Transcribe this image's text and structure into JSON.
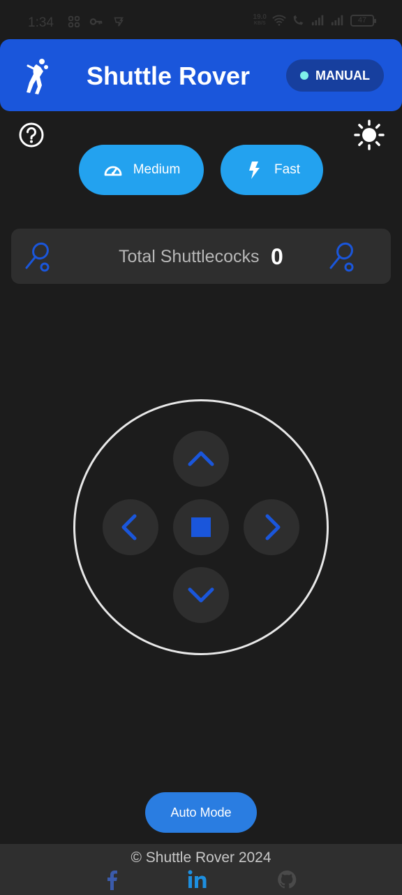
{
  "status_bar": {
    "time": "1:34",
    "net_speed_value": "19.0",
    "net_speed_unit": "KB/S",
    "battery": "47"
  },
  "header": {
    "title": "Shuttle Rover",
    "mode_badge": "MANUAL",
    "brand_color": "#1a56db"
  },
  "speed_buttons": [
    {
      "label": "Medium",
      "icon": "speedometer-icon"
    },
    {
      "label": "Fast",
      "icon": "bolt-icon"
    }
  ],
  "counter": {
    "label": "Total Shuttlecocks",
    "value": "0"
  },
  "controls": {
    "buttons": [
      "up",
      "left",
      "stop",
      "right",
      "down"
    ]
  },
  "auto_mode_button": "Auto Mode",
  "footer": {
    "copyright": "© Shuttle Rover 2024",
    "social": [
      "facebook-icon",
      "linkedin-icon",
      "github-icon"
    ]
  }
}
